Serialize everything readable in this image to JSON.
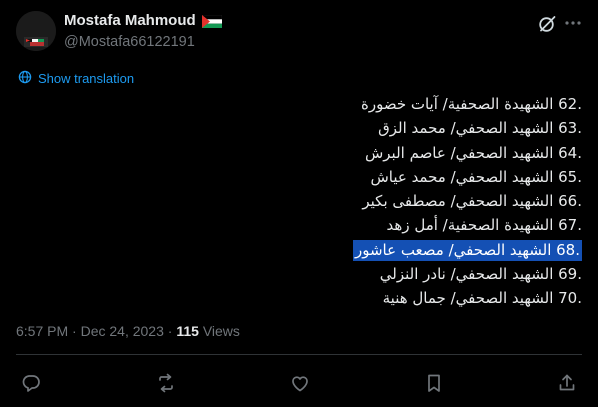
{
  "author": {
    "name": "Mostafa Mahmoud",
    "handle": "@Mostafa66122191",
    "avatar_lettering": "I STAND WITH PALESTINE",
    "flag_icon": "palestine-flag-icon"
  },
  "header": {
    "grok_icon": "grok-icon",
    "more_icon": "more-icon"
  },
  "translation": {
    "label": "Show translation",
    "icon": "globe-icon"
  },
  "tweet": {
    "lines": [
      {
        "num": "62.",
        "text": " الشهيدة الصحفية/ آيات خضورة"
      },
      {
        "num": "63.",
        "text": " الشهيد الصحفي/ محمد الزق"
      },
      {
        "num": "64.",
        "text": " الشهيد الصحفي/ عاصم البرش"
      },
      {
        "num": "65.",
        "text": " الشهيد الصحفي/ محمد عياش"
      },
      {
        "num": "66.",
        "text": " الشهيد الصحفي/ مصطفى بكير"
      },
      {
        "num": "67.",
        "text": " الشهيدة الصحفية/ أمل زهد"
      },
      {
        "num": "68.",
        "text": " الشهيد الصحفي/ مصعب عاشور",
        "selected": true
      },
      {
        "num": "69.",
        "text": " الشهيد الصحفي/ نادر النزلي"
      },
      {
        "num": "70.",
        "text": " الشهيد الصحفي/ جمال هنية"
      }
    ]
  },
  "meta": {
    "time": "6:57 PM",
    "separator1": "·",
    "date": "Dec 24, 2023",
    "separator2": "·",
    "views_count": "115",
    "views_label": "Views"
  },
  "actions": [
    {
      "name": "reply-icon"
    },
    {
      "name": "repost-icon"
    },
    {
      "name": "like-icon"
    },
    {
      "name": "bookmark-icon"
    },
    {
      "name": "share-icon"
    }
  ],
  "colors": {
    "background": "#000000",
    "text": "#e7e9ea",
    "muted": "#71767b",
    "link": "#1d9bf0",
    "selection": "#1450b4"
  }
}
